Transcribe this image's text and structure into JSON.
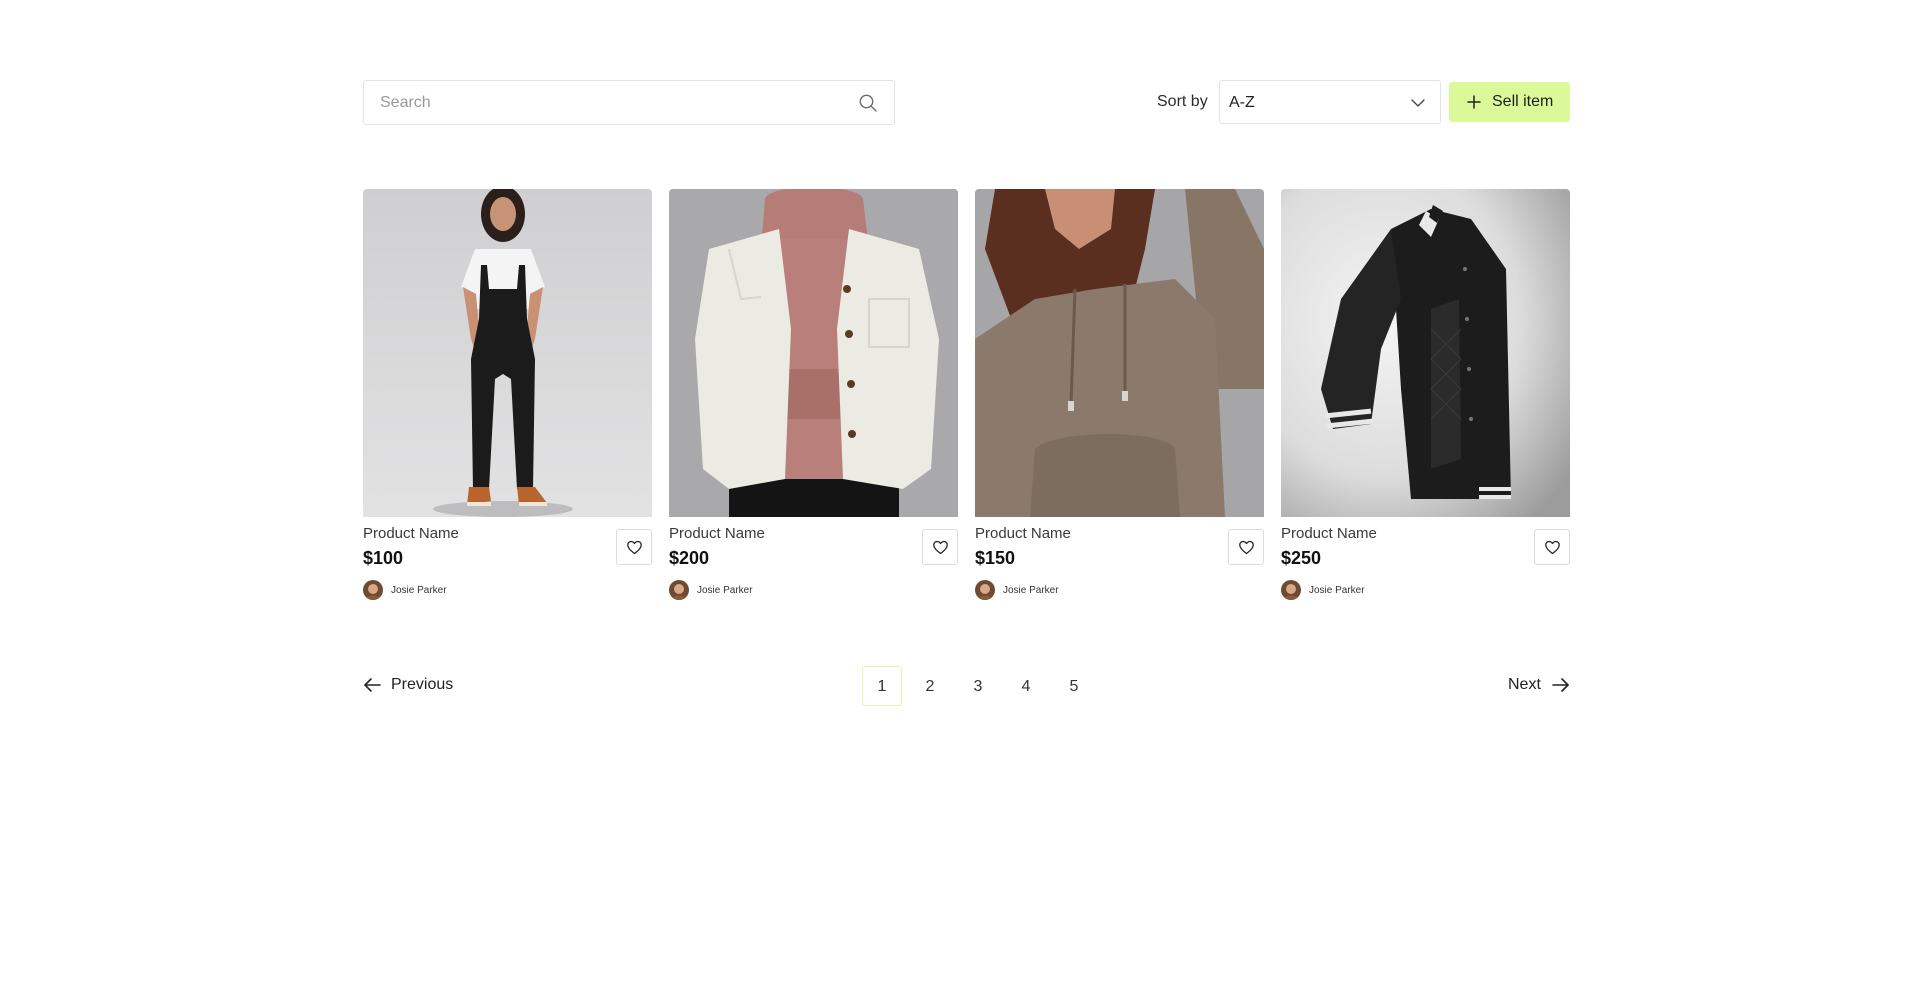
{
  "colors": {
    "accent": "#dcf99a",
    "active_page_border": "#e4f4b7",
    "border": "#e3e3e3"
  },
  "search": {
    "placeholder": "Search",
    "value": "",
    "icon": "search-icon"
  },
  "sort": {
    "label": "Sort by",
    "selected": "A-Z",
    "icon": "chevron-down-icon"
  },
  "sell_button": {
    "label": "Sell item",
    "icon": "plus-icon"
  },
  "products": [
    {
      "name": "Product Name",
      "price": "$100",
      "seller": "Josie Parker",
      "image": "woman-in-black-overalls"
    },
    {
      "name": "Product Name",
      "price": "$200",
      "seller": "Josie Parker",
      "image": "cream-jacket-pink-hoodie"
    },
    {
      "name": "Product Name",
      "price": "$150",
      "seller": "Josie Parker",
      "image": "taupe-hoodie"
    },
    {
      "name": "Product Name",
      "price": "$250",
      "seller": "Josie Parker",
      "image": "black-bomber-jacket"
    }
  ],
  "pagination": {
    "previous_label": "Previous",
    "next_label": "Next",
    "pages": [
      "1",
      "2",
      "3",
      "4",
      "5"
    ],
    "current_page": "1"
  }
}
